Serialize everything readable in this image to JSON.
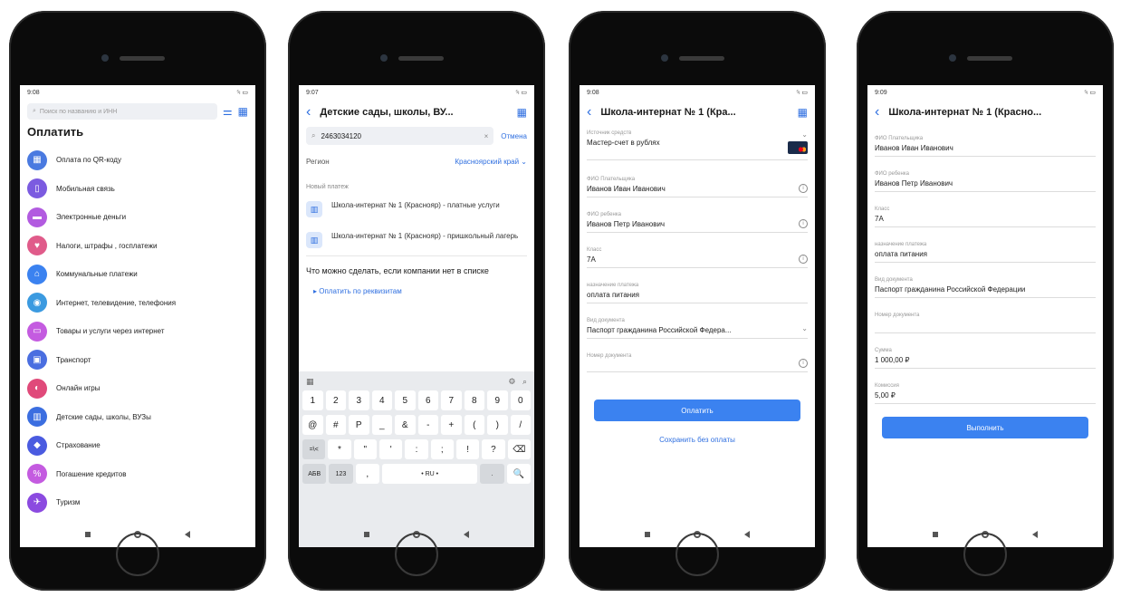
{
  "screen1": {
    "time": "9:08",
    "signal": "⁵ₗ ▭",
    "search_placeholder": "Поиск по названию и ИНН",
    "title": "Оплатить",
    "items": [
      {
        "label": "Оплата по QR-коду",
        "icon": "qr-icon",
        "color": "#4a7ae0",
        "glyph": "▦"
      },
      {
        "label": "Мобильная связь",
        "icon": "phone-icon",
        "color": "#7b5be0",
        "glyph": "▯"
      },
      {
        "label": "Электронные деньги",
        "icon": "folder-icon",
        "color": "#b25be0",
        "glyph": "▬"
      },
      {
        "label": "Налоги, штрафы , госплатежи",
        "icon": "heart-icon",
        "color": "#e05b8a",
        "glyph": "♥"
      },
      {
        "label": "Коммунальные платежи",
        "icon": "home-icon",
        "color": "#3b82f0",
        "glyph": "⌂"
      },
      {
        "label": "Интернет, телевидение, телефония",
        "icon": "wifi-icon",
        "color": "#3b9ae0",
        "glyph": "◉"
      },
      {
        "label": "Товары и услуги через интернет",
        "icon": "cart-icon",
        "color": "#c45be0",
        "glyph": "▭"
      },
      {
        "label": "Транспорт",
        "icon": "bus-icon",
        "color": "#4a6ee0",
        "glyph": "▣"
      },
      {
        "label": "Онлайн игры",
        "icon": "game-icon",
        "color": "#e04a7a",
        "glyph": "◐"
      },
      {
        "label": "Детские сады, школы, ВУЗы",
        "icon": "book-icon",
        "color": "#3b6ee0",
        "glyph": "▥"
      },
      {
        "label": "Страхование",
        "icon": "shield-icon",
        "color": "#4a5be0",
        "glyph": "◆"
      },
      {
        "label": "Погашение кредитов",
        "icon": "percent-icon",
        "color": "#c45be0",
        "glyph": "%"
      },
      {
        "label": "Туризм",
        "icon": "plane-icon",
        "color": "#8b4ae0",
        "glyph": "✈"
      }
    ]
  },
  "screen2": {
    "time": "9:07",
    "signal": "⁵ₗ ▭",
    "title": "Детские сады, школы, ВУ...",
    "search_value": "2463034120",
    "cancel": "Отмена",
    "region_label": "Регион",
    "region_value": "Красноярский край",
    "section": "Новый платеж",
    "results": [
      "Школа-интернат № 1 (Краснояр) - платные услуги",
      "Школа-интернат № 1 (Краснояр) - пришкольный лагерь"
    ],
    "question": "Что можно сделать, если компании нет в списке",
    "link": "Оплатить по реквизитам",
    "keyboard": {
      "row1": [
        "1",
        "2",
        "3",
        "4",
        "5",
        "6",
        "7",
        "8",
        "9",
        "0"
      ],
      "row2": [
        "@",
        "#",
        "P",
        "_",
        "&",
        "-",
        "+",
        "(",
        ")",
        "/"
      ],
      "row3": [
        "=\\<",
        "*",
        "\"",
        "'",
        ":",
        ";",
        "!",
        "?",
        "⌫"
      ],
      "row4": [
        "АБВ",
        "123",
        ",",
        "• RU •",
        ".",
        "🔍"
      ]
    }
  },
  "screen3": {
    "time": "9:08",
    "signal": "⁵ₗ ▭",
    "title": "Школа-интернат № 1 (Кра...",
    "fields": [
      {
        "label": "Источник средств",
        "value": "Мастер-счет в рублях"
      },
      {
        "label": "ФИО Плательщика",
        "value": "Иванов Иван Иванович"
      },
      {
        "label": "ФИО ребенка",
        "value": "Иванов Петр Иванович"
      },
      {
        "label": "Класс",
        "value": "7А"
      },
      {
        "label": "назначение платежа",
        "value": "оплата питания"
      },
      {
        "label": "Вид документа",
        "value": "Паспорт гражданина Российской Федера..."
      },
      {
        "label": "Номер документа",
        "value": ""
      }
    ],
    "pay_button": "Оплатить",
    "save_link": "Сохранить без оплаты"
  },
  "screen4": {
    "time": "9:09",
    "signal": "⁵ₗ ▭",
    "title": "Школа-интернат № 1 (Красно...",
    "fields": [
      {
        "label": "ФИО Плательщика",
        "value": "Иванов Иван Иванович"
      },
      {
        "label": "ФИО ребенка",
        "value": "Иванов Петр Иванович"
      },
      {
        "label": "Класс",
        "value": "7А"
      },
      {
        "label": "назначение платежа",
        "value": "оплата питания"
      },
      {
        "label": "Вид документа",
        "value": "Паспорт гражданина Российской Федерации"
      },
      {
        "label": "Номер документа",
        "value": ""
      },
      {
        "label": "Сумма",
        "value": "1 000,00 ₽"
      },
      {
        "label": "Комиссия",
        "value": "5,00 ₽"
      }
    ],
    "submit_button": "Выполнить"
  }
}
